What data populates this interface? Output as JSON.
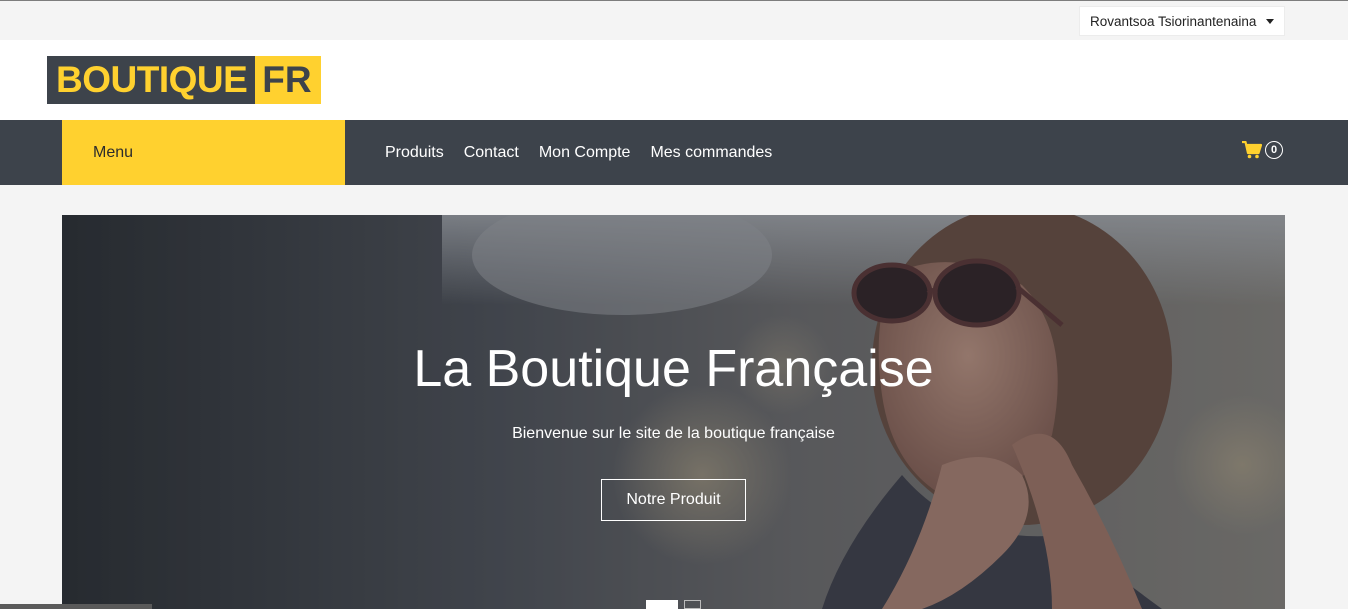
{
  "topbar": {
    "user_name": "Rovantsoa Tsiorinantenaina"
  },
  "logo": {
    "part1": "BOUTIQUE",
    "part2": "FR"
  },
  "nav": {
    "menu_label": "Menu",
    "links": [
      "Produits",
      "Contact",
      "Mon Compte",
      "Mes commandes"
    ],
    "cart_count": "0"
  },
  "hero": {
    "title": "La Boutique Française",
    "subtitle": "Bienvenue sur le site de la boutique française",
    "button_label": "Notre Produit"
  },
  "colors": {
    "accent": "#ffd12f",
    "dark": "#3d434b"
  }
}
